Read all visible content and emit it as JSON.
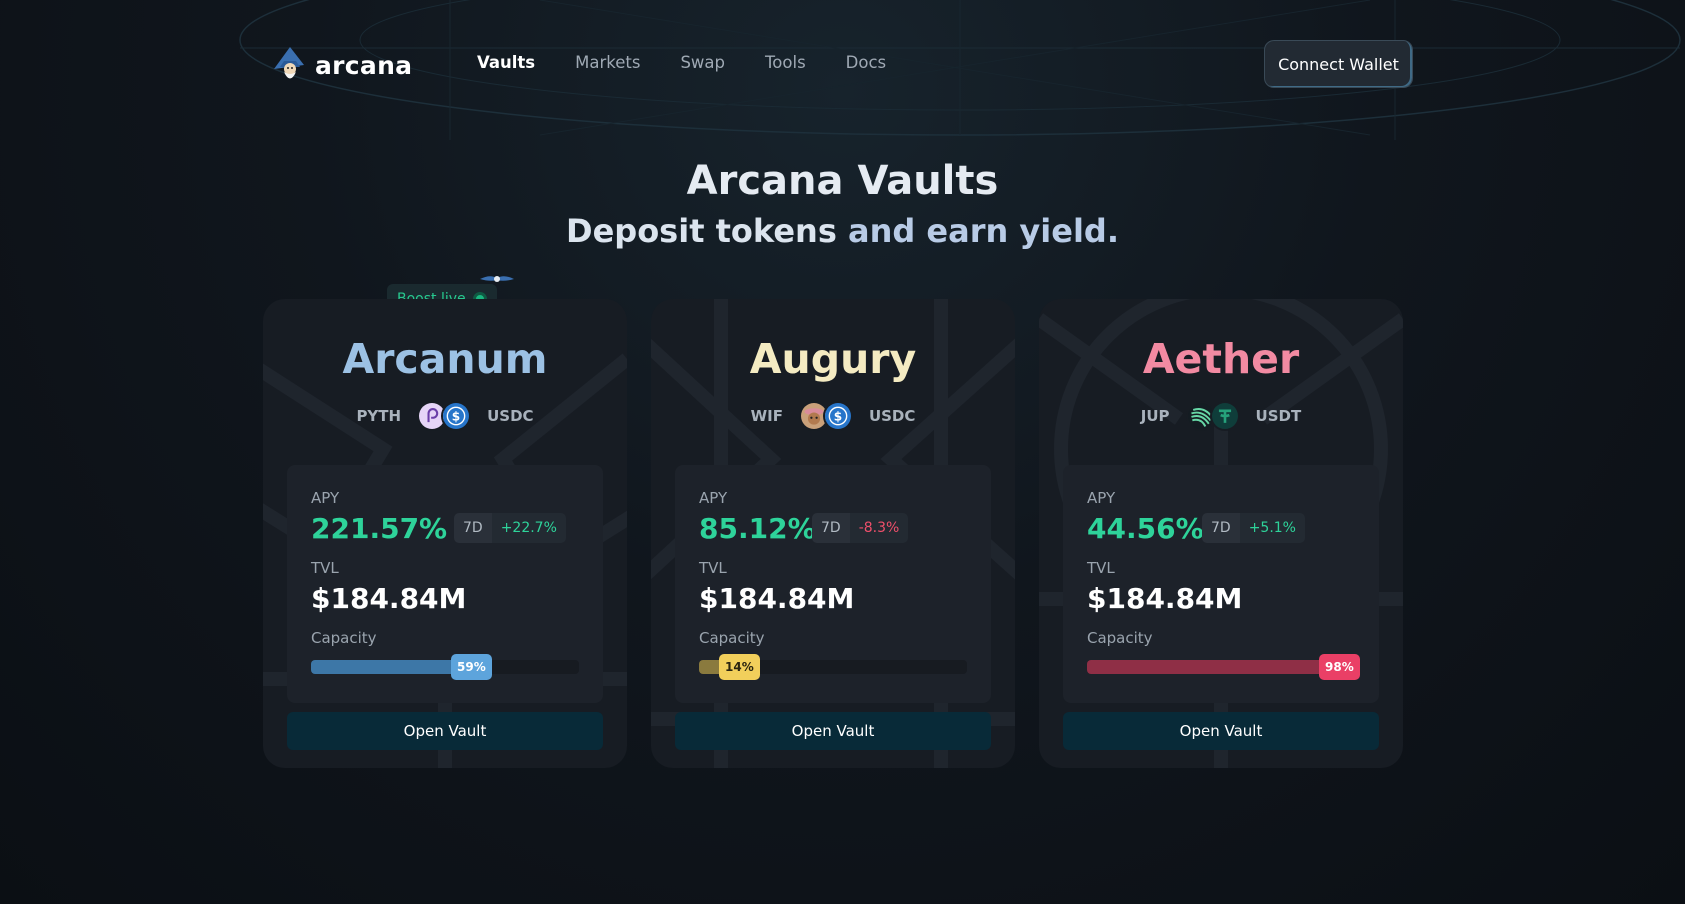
{
  "app": {
    "name": "arcana"
  },
  "nav": {
    "items": [
      {
        "label": "Vaults",
        "active": true
      },
      {
        "label": "Markets",
        "active": false
      },
      {
        "label": "Swap",
        "active": false
      },
      {
        "label": "Tools",
        "active": false
      },
      {
        "label": "Docs",
        "active": false
      }
    ],
    "connect_label": "Connect Wallet"
  },
  "hero": {
    "title": "Arcana Vaults",
    "subtitle_plain": "Deposit tokens ",
    "subtitle_highlight": "and earn yield."
  },
  "boost": {
    "label": "Boost live"
  },
  "labels": {
    "apy": "APY",
    "tvl": "TVL",
    "capacity": "Capacity",
    "period": "7D",
    "open": "Open Vault"
  },
  "vaults": [
    {
      "name": "Arcanum",
      "name_color": "#9cc1e4",
      "token_a": "PYTH",
      "token_b": "USDC",
      "icon_a": "pyth-icon",
      "icon_b": "usdc-icon",
      "apy": "221.57%",
      "change": "+22.7%",
      "change_positive": true,
      "tvl": "$184.84M",
      "capacity": "59%",
      "capacity_fraction": 0.59,
      "fill_color": "#3d77a7",
      "badge_color": "#5da4dc",
      "badge_text_color": "#ffffff"
    },
    {
      "name": "Augury",
      "name_color": "#f4ebc2",
      "token_a": "WIF",
      "token_b": "USDC",
      "icon_a": "wif-icon",
      "icon_b": "usdc-icon",
      "apy": "85.12%",
      "change": "-8.3%",
      "change_positive": false,
      "tvl": "$184.84M",
      "capacity": "14%",
      "capacity_fraction": 0.14,
      "fill_color": "#8a7a3e",
      "badge_color": "#f2cf5b",
      "badge_text_color": "#2a2410"
    },
    {
      "name": "Aether",
      "name_color": "#f28aa2",
      "token_a": "JUP",
      "token_b": "USDT",
      "icon_a": "jup-icon",
      "icon_b": "usdt-icon",
      "apy": "44.56%",
      "change": "+5.1%",
      "change_positive": true,
      "tvl": "$184.84M",
      "capacity": "98%",
      "capacity_fraction": 0.98,
      "fill_color": "#8f2f46",
      "badge_color": "#ea3f66",
      "badge_text_color": "#ffffff"
    }
  ],
  "colors": {
    "positive": "#2ed39a",
    "negative": "#ef4f6b",
    "accent_green": "#27c98f"
  }
}
